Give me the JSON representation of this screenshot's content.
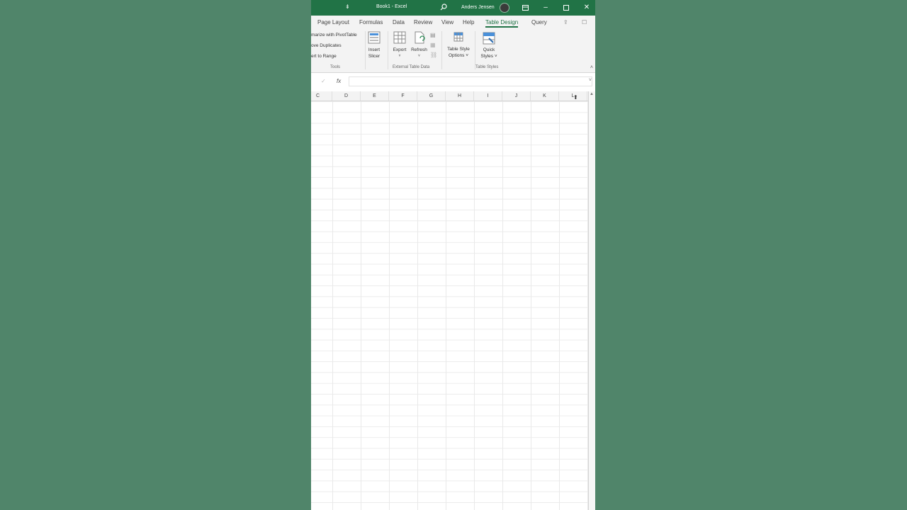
{
  "window": {
    "title": "Book1 - Excel",
    "user": "Anders Jensen"
  },
  "tabs": [
    {
      "label": "Page Layout"
    },
    {
      "label": "Formulas"
    },
    {
      "label": "Data"
    },
    {
      "label": "Review"
    },
    {
      "label": "View"
    },
    {
      "label": "Help"
    },
    {
      "label": "Table Design"
    },
    {
      "label": "Query"
    }
  ],
  "active_tab": "Table Design",
  "ribbon": {
    "tools": {
      "items": [
        "marize with PivotTable",
        "ove Duplicates",
        "ert to Range"
      ],
      "group_label": "Tools"
    },
    "insert_slicer": "Insert\nSlicer",
    "insert_slicer_line1": "Insert",
    "insert_slicer_line2": "Slicer",
    "external": {
      "export": "Export",
      "refresh": "Refresh",
      "group_label": "External Table Data"
    },
    "style_options": {
      "line1": "Table Style",
      "line2": "Options ˅"
    },
    "quick_styles": {
      "line1": "Quick",
      "line2": "Styles ˅",
      "group_label": "Table Styles"
    }
  },
  "formula_bar": {
    "fx": "fx",
    "value": ""
  },
  "columns": [
    "C",
    "D",
    "E",
    "F",
    "G",
    "H",
    "I",
    "J",
    "K",
    "L"
  ],
  "colors": {
    "excel_green": "#217346",
    "background": "#50856a"
  }
}
